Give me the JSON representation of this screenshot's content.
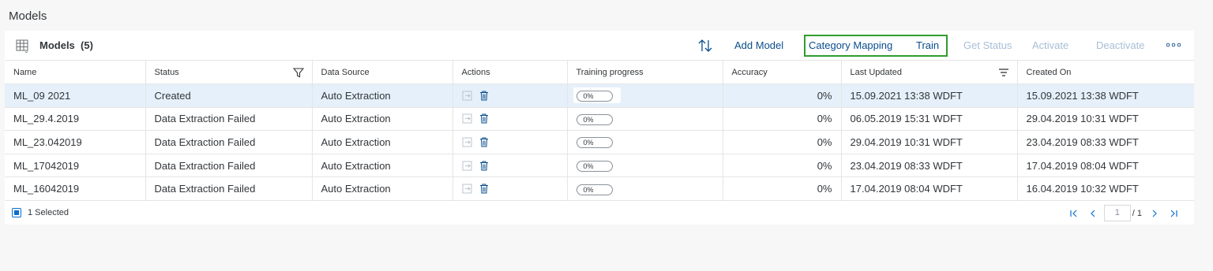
{
  "page_title": "Models",
  "toolbar": {
    "title": "Models",
    "count": "(5)",
    "buttons": {
      "add_model": "Add Model",
      "category_mapping": "Category Mapping",
      "train": "Train",
      "get_status": "Get Status",
      "activate": "Activate",
      "deactivate": "Deactivate"
    },
    "icons": [
      "table-grid-icon",
      "sort-icon",
      "more-icon"
    ]
  },
  "table": {
    "columns": [
      "Name",
      "Status",
      "Data Source",
      "Actions",
      "Training progress",
      "Accuracy",
      "Last Updated",
      "Created On"
    ],
    "rows": [
      {
        "name": "ML_09 2021",
        "status": "Created",
        "source": "Auto Extraction",
        "progress": "0%",
        "accuracy": "0%",
        "last_updated": "15.09.2021 13:38 WDFT",
        "created_on": "15.09.2021 13:38 WDFT",
        "selected": true
      },
      {
        "name": "ML_29.4.2019",
        "status": "Data Extraction Failed",
        "source": "Auto Extraction",
        "progress": "0%",
        "accuracy": "0%",
        "last_updated": "06.05.2019 15:31 WDFT",
        "created_on": "29.04.2019 10:31 WDFT",
        "selected": false
      },
      {
        "name": "ML_23.042019",
        "status": "Data Extraction Failed",
        "source": "Auto Extraction",
        "progress": "0%",
        "accuracy": "0%",
        "last_updated": "29.04.2019 10:31 WDFT",
        "created_on": "23.04.2019 08:33 WDFT",
        "selected": false
      },
      {
        "name": "ML_17042019",
        "status": "Data Extraction Failed",
        "source": "Auto Extraction",
        "progress": "0%",
        "accuracy": "0%",
        "last_updated": "23.04.2019 08:33 WDFT",
        "created_on": "17.04.2019 08:04 WDFT",
        "selected": false
      },
      {
        "name": "ML_16042019",
        "status": "Data Extraction Failed",
        "source": "Auto Extraction",
        "progress": "0%",
        "accuracy": "0%",
        "last_updated": "17.04.2019 08:04 WDFT",
        "created_on": "16.04.2019 10:32 WDFT",
        "selected": false
      }
    ]
  },
  "footer": {
    "selected_label": "1 Selected",
    "page_input": "1",
    "page_total": "/ 1"
  },
  "colors": {
    "accent": "#0a6ed1",
    "link": "#0a4d8c",
    "disabled": "#a7bed6",
    "selected_row": "#e5f0fa",
    "highlight_box": "#2f9d2f"
  }
}
